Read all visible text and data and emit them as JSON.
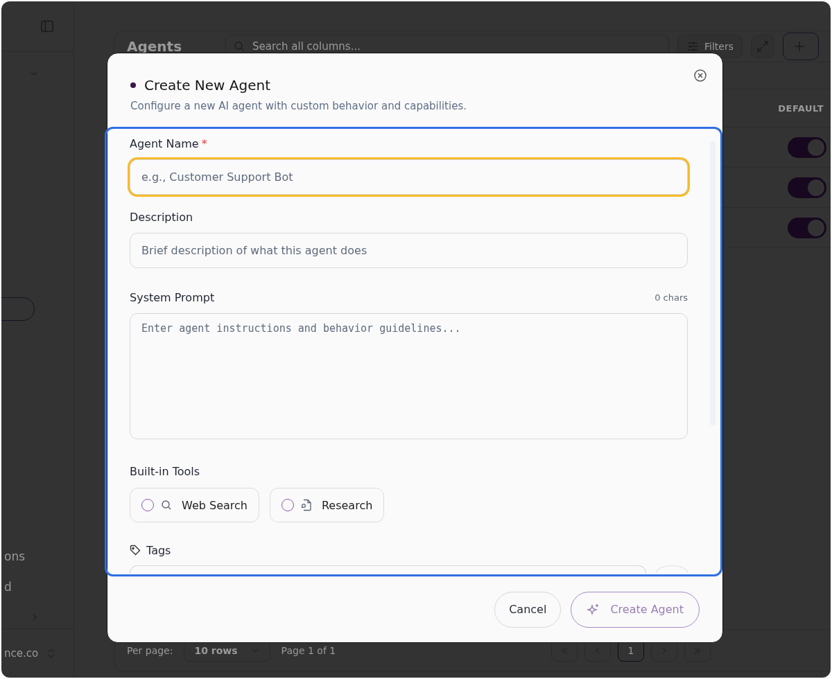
{
  "sidebar": {
    "items": [
      {
        "label": "ons"
      },
      {
        "label": "d"
      }
    ],
    "account": "nce.co"
  },
  "page": {
    "title": "Agents",
    "search": {
      "placeholder": "Search all columns..."
    },
    "filters_button": "Filters",
    "table": {
      "columns": [
        {
          "label": "DEFAULT"
        }
      ],
      "rows": [
        {
          "default": true
        },
        {
          "default": true
        },
        {
          "default": true
        }
      ]
    },
    "pagination": {
      "per_page_label": "Per page:",
      "per_page_value": "10 rows",
      "page_info": "Page 1 of 1",
      "pages": [
        {
          "label": "1",
          "selected": true
        }
      ]
    }
  },
  "dialog": {
    "title": "Create New Agent",
    "subtitle": "Configure a new AI agent with custom behavior and capabilities.",
    "required_mark": "*",
    "fields": [
      {
        "kind": "text",
        "label": "Agent Name",
        "required": true,
        "focused": true,
        "placeholder": "e.g., Customer Support Bot"
      },
      {
        "kind": "text",
        "label": "Description",
        "required": false,
        "focused": false,
        "placeholder": "Brief description of what this agent does"
      },
      {
        "kind": "textarea",
        "label": "System Prompt",
        "required": false,
        "focused": false,
        "counter": "0 chars",
        "placeholder": "Enter agent instructions and behavior guidelines..."
      }
    ],
    "tools": {
      "label": "Built-in Tools",
      "items": [
        {
          "kind": "search",
          "label": "Web Search",
          "checked": false
        },
        {
          "kind": "research",
          "label": "Research",
          "checked": false
        }
      ]
    },
    "tags": {
      "label": "Tags"
    },
    "buttons": {
      "cancel": "Cancel",
      "create": {
        "label": "Create Agent",
        "disabled": true
      }
    }
  }
}
